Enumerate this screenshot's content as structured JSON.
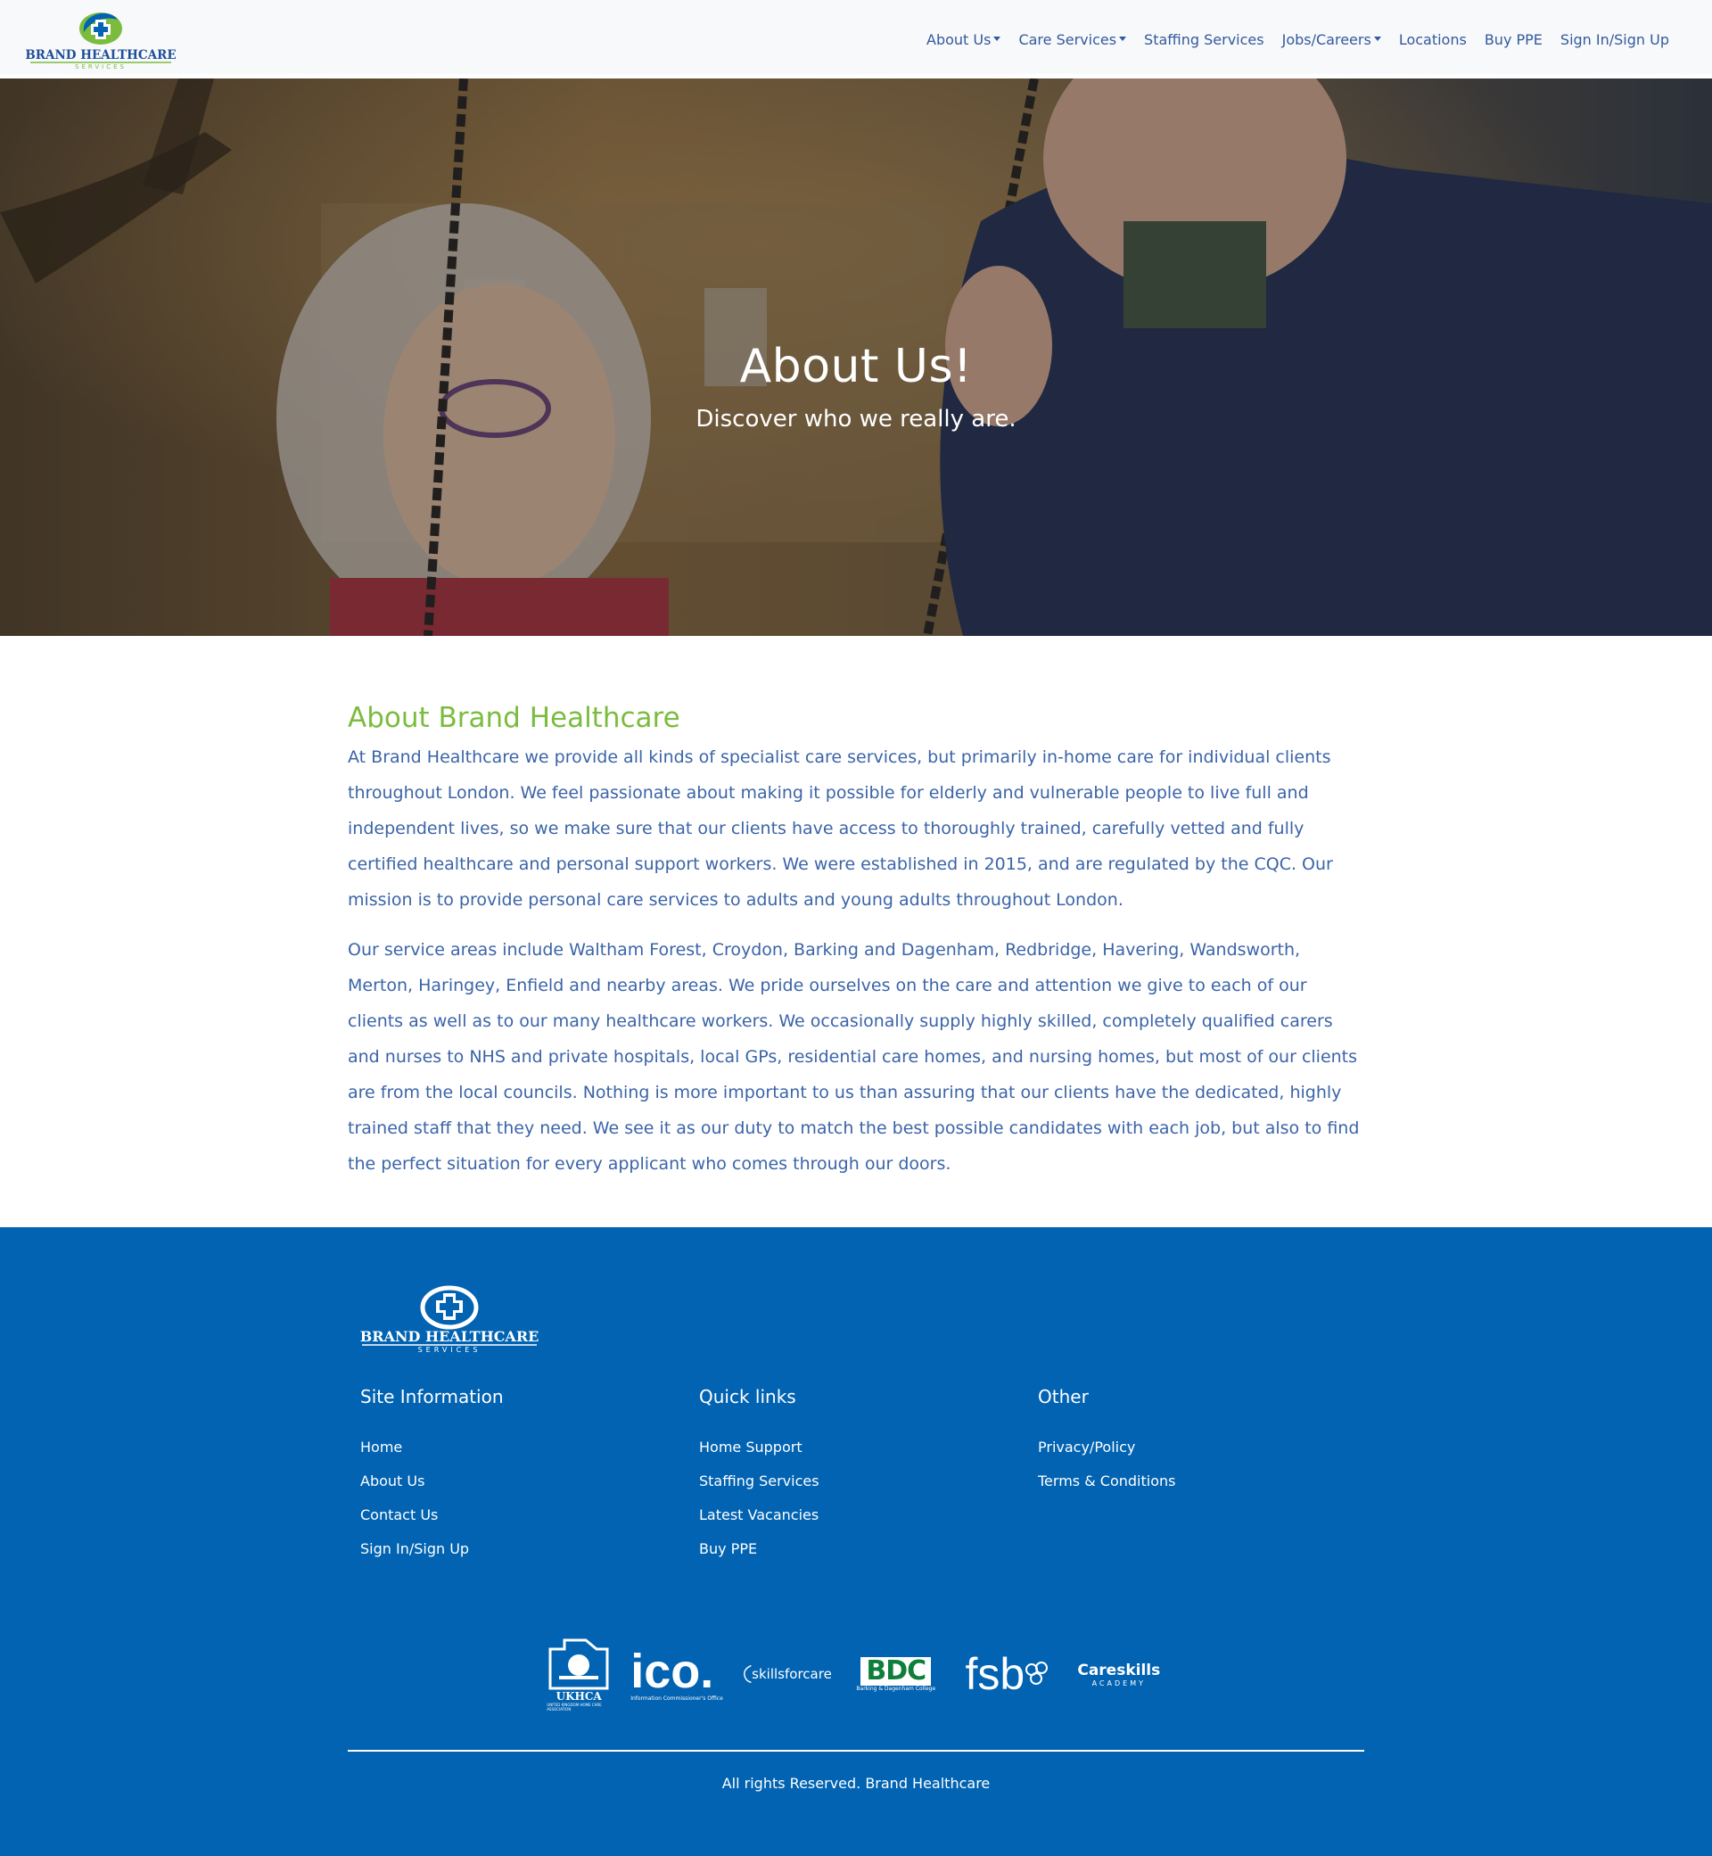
{
  "brand": {
    "name": "BRAND HEALTHCARE",
    "tagline": "SERVICES",
    "colors": {
      "primary_blue": "#0163b2",
      "nav_text": "#33599e",
      "accent_green": "#7bbc3f",
      "body_text": "#3b64a8"
    }
  },
  "nav": {
    "items": [
      {
        "label": "About Us",
        "dropdown": true
      },
      {
        "label": "Care Services",
        "dropdown": true
      },
      {
        "label": "Staffing Services",
        "dropdown": false
      },
      {
        "label": "Jobs/Careers",
        "dropdown": true
      },
      {
        "label": "Locations",
        "dropdown": false
      },
      {
        "label": "Buy PPE",
        "dropdown": false
      },
      {
        "label": "Sign In/Sign Up",
        "dropdown": false
      }
    ]
  },
  "hero": {
    "title": "About Us!",
    "subtitle": "Discover who we really are."
  },
  "about": {
    "heading": "About Brand Healthcare",
    "paragraphs": [
      "At Brand Healthcare we provide all kinds of specialist care services, but primarily in-home care for individual clients throughout London. We feel passionate about making it possible for elderly and vulnerable people to live full and independent lives, so we make sure that our clients have access to thoroughly trained, carefully vetted and fully certified healthcare and personal support workers. We were established in 2015, and are regulated by the CQC. Our mission is to provide personal care services to adults and young adults throughout London.",
      "Our service areas include Waltham Forest, Croydon, Barking and Dagenham, Redbridge, Havering, Wandsworth, Merton, Haringey, Enfield and nearby areas. We pride ourselves on the care and attention we give to each of our clients as well as to our many healthcare workers. We occasionally supply highly skilled, completely qualified carers and nurses to NHS and private hospitals, local GPs, residential care homes, and nursing homes, but most of our clients are from the local councils. Nothing is more important to us than assuring that our clients have the dedicated, highly trained staff that they need. We see it as our duty to match the best possible candidates with each job, but also to find the perfect situation for every applicant who comes through our doors."
    ]
  },
  "footer": {
    "columns": [
      {
        "heading": "Site Information",
        "links": [
          "Home",
          "About Us",
          "Contact Us",
          "Sign In/Sign Up"
        ]
      },
      {
        "heading": "Quick links",
        "links": [
          "Home Support",
          "Staffing Services",
          "Latest Vacancies",
          "Buy PPE"
        ]
      },
      {
        "heading": "Other",
        "links": [
          "Privacy/Policy",
          "Terms & Conditions"
        ]
      }
    ],
    "badges": [
      {
        "name": "ukhca-logo",
        "text": "UKHCA",
        "sub": "UNITED KINGDOM HOME CARE ASSOCIATION"
      },
      {
        "name": "ico-logo",
        "text": "ico.",
        "sub": "Information Commissioner's Office"
      },
      {
        "name": "skills-for-care-logo",
        "text": "skillsforcare"
      },
      {
        "name": "bdc-logo",
        "text": "BDC",
        "sub": "Barking & Dagenham College"
      },
      {
        "name": "fsb-logo",
        "text": "fsb"
      },
      {
        "name": "careskills-logo",
        "text": "Careskills",
        "sub": "ACADEMY"
      }
    ],
    "copyright": "All rights Reserved. Brand Healthcare"
  }
}
